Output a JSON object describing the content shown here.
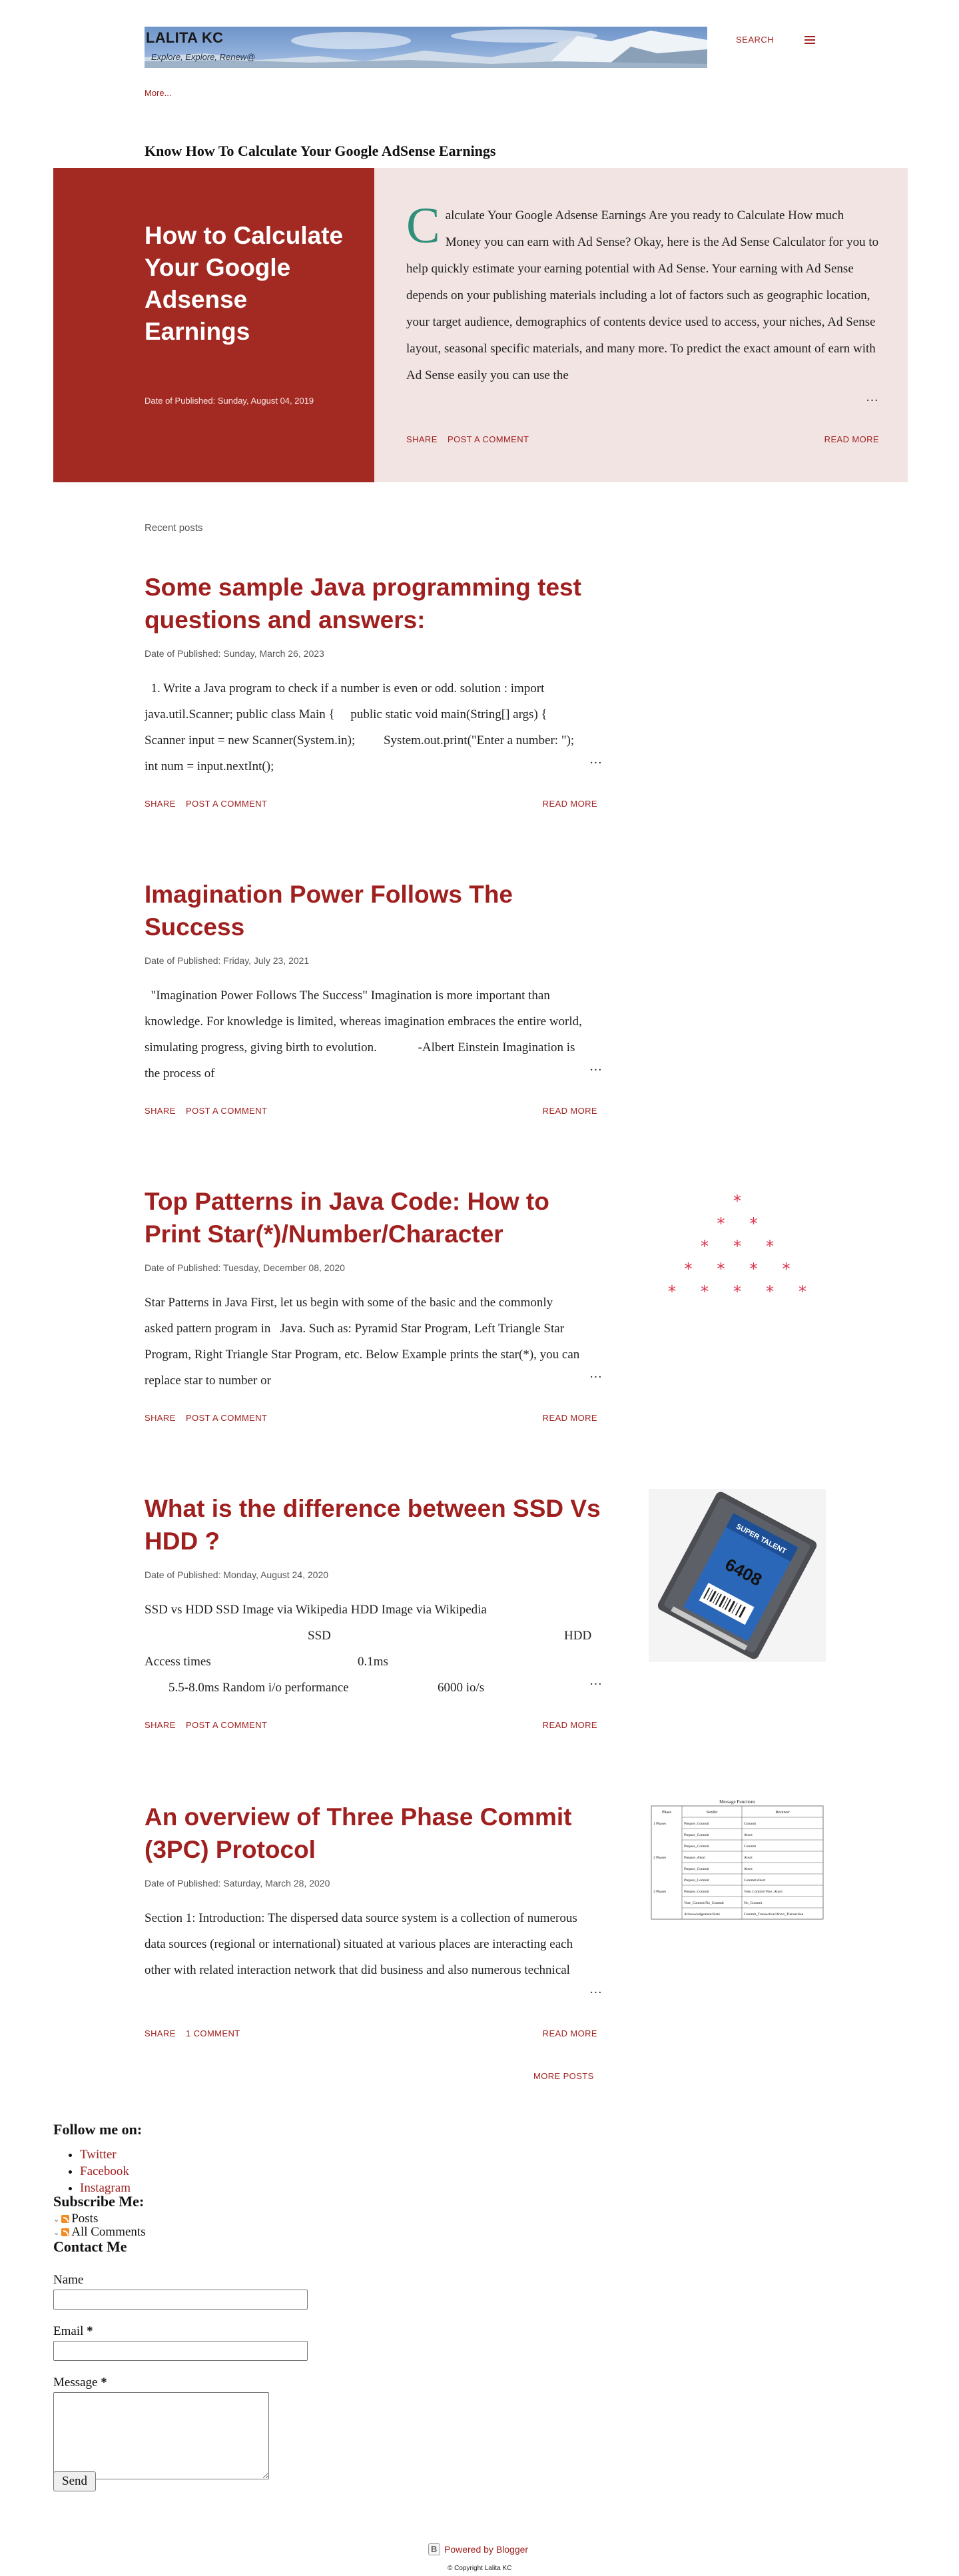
{
  "header": {
    "blog_title": "LALITA KC",
    "tagline": "Explore, Explore, Renew@",
    "search_label": "SEARCH",
    "more_link": "More..."
  },
  "featured": {
    "section_label": "Know How To Calculate Your Google AdSense Earnings",
    "title": "How to Calculate Your Google Adsense Earnings",
    "date": "Date of Published: Sunday, August 04, 2019",
    "dropcap": "C",
    "snippet": "alculate Your Google Adsense Earnings Are you ready to Calculate How much Money you can earn with Ad Sense? Okay, here is the Ad Sense Calculator for you to help quickly estimate your earning potential with Ad Sense. Your earning with Ad Sense depends on your publishing materials including a lot of factors such as geographic location, your target audience, demographics of contents device used to access, your niches, Ad Sense layout, seasonal specific materials, and many more. To predict the exact amount of earn with Ad Sense easily you can use the",
    "ellipsis": "…",
    "share": "SHARE",
    "comment": "POST A COMMENT",
    "read_more": "READ MORE"
  },
  "recent_label": "Recent posts",
  "posts": [
    {
      "title": "Some sample Java programming test questions and answers:",
      "date": "Date of Published: Sunday, March 26, 2023",
      "snippet": "  1. Write a Java program to check if a number is even or odd. solution : import java.util.Scanner; public class Main {     public static void main(String[] args) {         Scanner input = new Scanner(System.in);         System.out.print(\"Enter a number: \");         int num = input.nextInt();",
      "ellipsis": "…",
      "share": "SHARE",
      "comment": "POST A COMMENT",
      "read_more": "READ MORE"
    },
    {
      "title": "Imagination Power Follows The Success",
      "date": "Date of Published: Friday, July 23, 2021",
      "snippet": "  \"Imagination Power Follows The Success\" Imagination is more important than knowledge. For knowledge is limited, whereas imagination embraces the entire world, simulating progress, giving birth to evolution.             -Albert Einstein Imagination is the process of",
      "ellipsis": "…",
      "share": "SHARE",
      "comment": "POST A COMMENT",
      "read_more": "READ MORE"
    },
    {
      "title": "Top Patterns in Java Code: How to Print Star(*)/Number/Character",
      "date": "Date of Published: Tuesday, December 08, 2020",
      "snippet": "Star Patterns in Java First, let us begin with some of the basic and the commonly asked pattern program in   Java. Such as: Pyramid Star Program, Left Triangle Star Program, Right Triangle Star Program, etc. Below Example prints the star(*), you can replace star to number or",
      "ellipsis": "…",
      "share": "SHARE",
      "comment": "POST A COMMENT",
      "read_more": "READ MORE",
      "image_glyph": "*"
    },
    {
      "title": "What is the difference between SSD Vs HDD ?",
      "date": "Date of Published: Monday, August 24, 2020",
      "snippet_line1": "SSD vs HDD SSD Image via Wikipedia HDD Image via Wikipedia",
      "snippet_col_a": "SSD",
      "snippet_col_b": "HDD",
      "snippet_line3_label": "Access times",
      "snippet_line3_value": "0.1ms",
      "snippet_line4_a": "5.5-8.0ms Random i/o performance",
      "snippet_line4_b": "6000 io/s",
      "ellipsis": "…",
      "share": "SHARE",
      "comment": "POST A COMMENT",
      "read_more": "READ MORE",
      "image_text": "6408",
      "image_brand": "SUPER TALENT"
    },
    {
      "title": "An overview of Three Phase Commit (3PC) Protocol",
      "date": "Date of Published: Saturday, March 28, 2020",
      "snippet": "Section 1: Introduction: The dispersed data source system is a collection of numerous data sources (regional or international) situated at various places are interacting each other with related interaction network that did business and also numerous technical",
      "ellipsis": "…",
      "share": "SHARE",
      "comment": "1 COMMENT",
      "read_more": "READ MORE",
      "image_table_title": "Message Functions",
      "image_table_headers": [
        "Phase",
        "Sender",
        "Receiver"
      ],
      "image_table_rows": [
        [
          "1 Phases",
          "Prepare_Commit",
          "Commit"
        ],
        [
          "",
          "Prepare_Commit",
          "Abort"
        ],
        [
          "",
          "Prepare_Commit",
          "Commit"
        ],
        [
          "2 Phases",
          "Prepare_Abort",
          "Abort"
        ],
        [
          "",
          "Prepare_Commit",
          "Abort"
        ],
        [
          "",
          "Prepare_Commit",
          "Commit/Abort"
        ],
        [
          "3 Phases",
          "Prepare_Commit",
          "Vote_Commit/Vote_Abort"
        ],
        [
          "",
          "Vote_Commit/No_Commit",
          "No_Commit"
        ],
        [
          "",
          "Acknowledgement/State",
          "Commit_Transaction/Abort_Transaction"
        ]
      ]
    }
  ],
  "more_posts": "MORE POSTS",
  "follow": {
    "title": "Follow me on:",
    "items": [
      "Twitter",
      "Facebook",
      "Instagram"
    ]
  },
  "subscribe": {
    "title": "Subscribe Me:",
    "items": [
      "Posts",
      "All Comments"
    ]
  },
  "contact": {
    "title": "Contact Me",
    "name_label": "Name",
    "email_label": "Email",
    "required_mark": "*",
    "message_label": "Message",
    "send_label": "Send"
  },
  "footer": {
    "powered": "Powered by Blogger",
    "copyright": "© Copyright Lalita KC"
  },
  "colors": {
    "accent": "#a0201f",
    "featured_panel": "#a32a22",
    "featured_bg": "#f1e4e3",
    "dropcap": "#2f8f7a"
  }
}
